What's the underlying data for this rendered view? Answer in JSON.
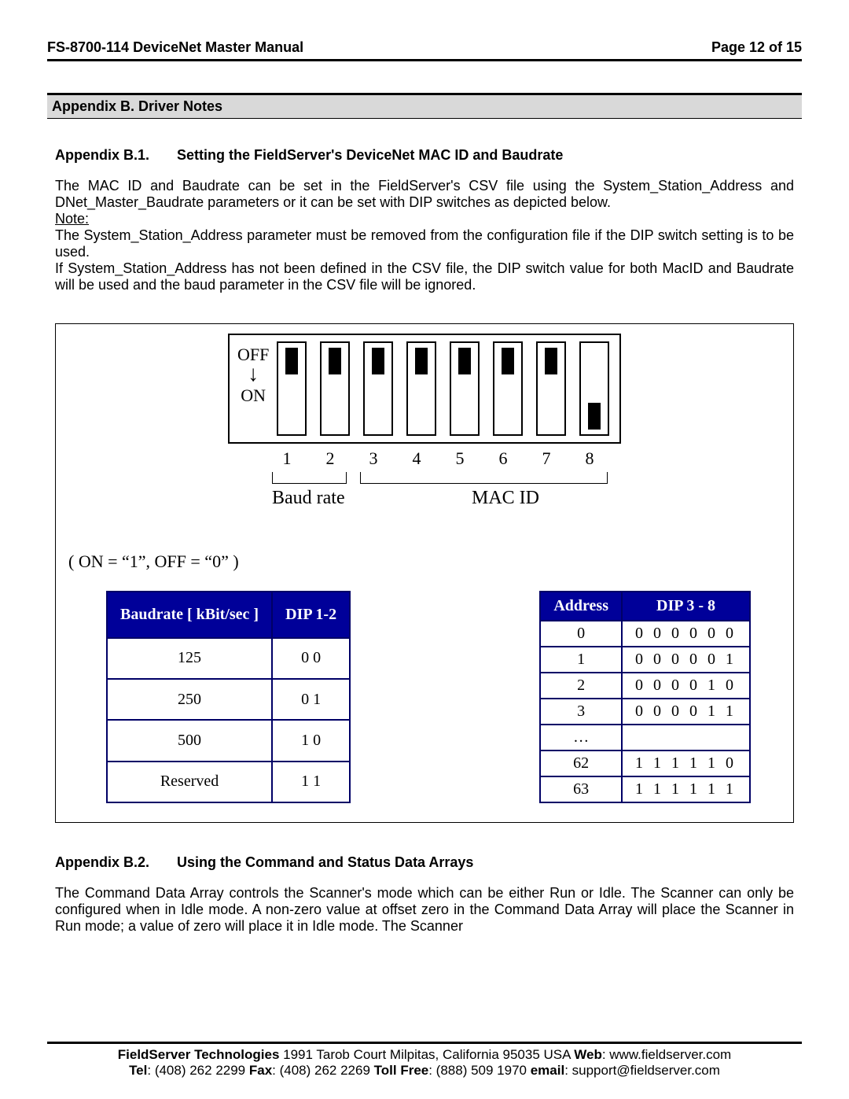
{
  "header": {
    "left": "FS-8700-114 DeviceNet Master Manual",
    "right": "Page 12 of 15"
  },
  "appendix_bar": "Appendix B.   Driver Notes",
  "section1": {
    "num": "Appendix B.1.",
    "title": "Setting the FieldServer's DeviceNet MAC ID and Baudrate",
    "para1": "The MAC ID and Baudrate can be set in the FieldServer's CSV file using the System_Station_Address and DNet_Master_Baudrate parameters or it can be set with DIP switches as depicted below.",
    "note_label": "Note:",
    "para2": "The System_Station_Address parameter must be removed from the configuration file if the DIP switch setting is to be used.",
    "para3": "If System_Station_Address has not been defined in the CSV file, the DIP switch value for both MacID and Baudrate will be used and the baud parameter in the CSV file will be ignored."
  },
  "diagram": {
    "off": "OFF",
    "on": "ON",
    "switches": [
      {
        "n": "1",
        "pos": "off"
      },
      {
        "n": "2",
        "pos": "off"
      },
      {
        "n": "3",
        "pos": "off"
      },
      {
        "n": "4",
        "pos": "off"
      },
      {
        "n": "5",
        "pos": "off"
      },
      {
        "n": "6",
        "pos": "off"
      },
      {
        "n": "7",
        "pos": "off"
      },
      {
        "n": "8",
        "pos": "on"
      }
    ],
    "group1": "Baud rate",
    "group2": "MAC ID",
    "legend": "( ON = “1”, OFF = “0” )"
  },
  "baud_table": {
    "h1": "Baudrate [ kBit/sec ]",
    "h2": "DIP 1-2",
    "rows": [
      {
        "a": "125",
        "b": "0 0"
      },
      {
        "a": "250",
        "b": "0 1"
      },
      {
        "a": "500",
        "b": "1 0"
      },
      {
        "a": "Reserved",
        "b": "1 1"
      }
    ]
  },
  "addr_table": {
    "h1": "Address",
    "h2": "DIP 3 - 8",
    "rows": [
      {
        "a": "0",
        "b": "0 0 0 0 0 0"
      },
      {
        "a": "1",
        "b": "0 0 0 0 0 1"
      },
      {
        "a": "2",
        "b": "0 0 0 0 1 0"
      },
      {
        "a": "3",
        "b": "0 0 0 0 1 1"
      },
      {
        "a": "…",
        "b": ""
      },
      {
        "a": "62",
        "b": "1 1 1 1 1 0"
      },
      {
        "a": "63",
        "b": "1 1 1 1 1 1"
      }
    ]
  },
  "section2": {
    "num": "Appendix B.2.",
    "title": "Using the Command and Status Data Arrays",
    "para": "The Command Data Array controls the Scanner's mode which can be either Run or Idle. The Scanner can only be configured when in Idle mode.  A non-zero value at offset zero in the Command Data Array will place the Scanner in Run mode; a value of zero will place it in Idle mode.  The Scanner"
  },
  "footer": {
    "line1a": "FieldServer Technologies",
    "line1b": " 1991 Tarob Court Milpitas, California 95035 USA   ",
    "web_label": "Web",
    "web": ": www.fieldserver.com",
    "tel_label": "Tel",
    "tel": ": (408) 262 2299   ",
    "fax_label": "Fax",
    "fax": ": (408) 262 2269   ",
    "tf_label": "Toll Free",
    "tf": ": (888) 509 1970   ",
    "em_label": "email",
    "em": ": support@fieldserver.com"
  }
}
